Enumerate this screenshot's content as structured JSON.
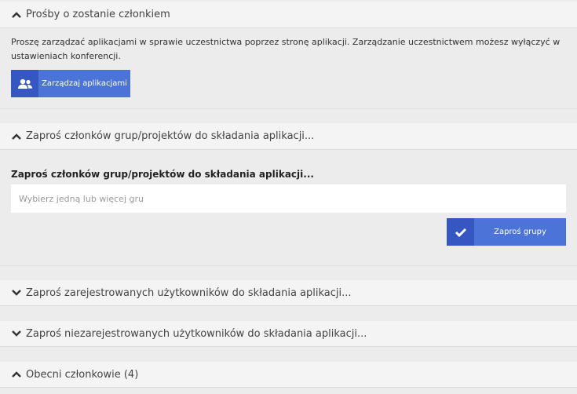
{
  "sections": {
    "requests": {
      "title": "Prośby o zostanie członkiem",
      "description": "Proszę zarządzać aplikacjami w sprawie uczestnictwa poprzez stronę aplikacji. Zarządzanie uczestnictwem możesz wyłączyć w ustawieniach konferencji.",
      "button_label": "Zarządzaj aplikacjami",
      "button_icon": "users-icon"
    },
    "invite_groups": {
      "title": "Zaproś członków grup/projektów do składania aplikacji...",
      "field_label": "Zaproś członków grup/projektów do składania aplikacji...",
      "input_placeholder": "Wybierz jedną lub więcej gru",
      "button_label": "Zaproś grupy",
      "button_icon": "check-icon"
    },
    "invite_registered": {
      "title": "Zaproś zarejestrowanych użytkowników do składania aplikacji..."
    },
    "invite_unregistered": {
      "title": "Zaproś niezarejestrowanych użytkowników do składania aplikacji..."
    },
    "current_members": {
      "title": "Obecni członkowie (4)"
    }
  },
  "colors": {
    "accent": "#4c73d8",
    "accent_dark": "#3657c2",
    "background": "#ececec",
    "header_background": "#f4f4f4"
  }
}
